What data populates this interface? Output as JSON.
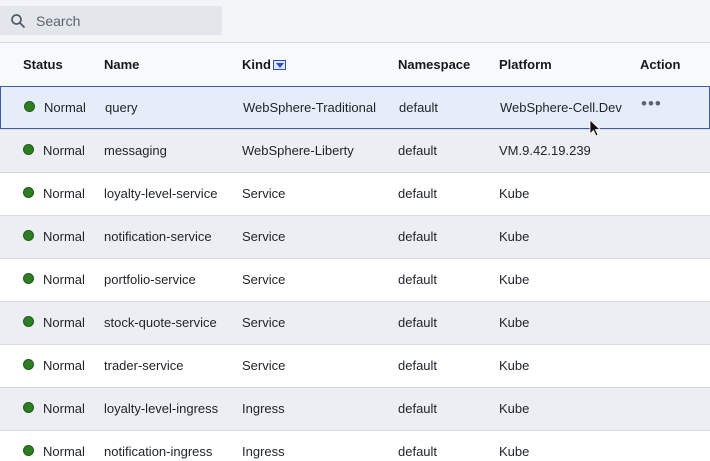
{
  "search": {
    "placeholder": "Search"
  },
  "columns": [
    "Status",
    "Name",
    "Kind",
    "Namespace",
    "Platform",
    "Action"
  ],
  "status_color": "#2f7d23",
  "selected_row_border": "#3b5da7",
  "rows": [
    {
      "status": "Normal",
      "name": "query",
      "kind": "WebSphere-Traditional",
      "namespace": "default",
      "platform": "WebSphere-Cell.Dev",
      "action": "•••"
    },
    {
      "status": "Normal",
      "name": "messaging",
      "kind": "WebSphere-Liberty",
      "namespace": "default",
      "platform": "VM.9.42.19.239",
      "action": ""
    },
    {
      "status": "Normal",
      "name": "loyalty-level-service",
      "kind": "Service",
      "namespace": "default",
      "platform": "Kube",
      "action": ""
    },
    {
      "status": "Normal",
      "name": "notification-service",
      "kind": "Service",
      "namespace": "default",
      "platform": "Kube",
      "action": ""
    },
    {
      "status": "Normal",
      "name": "portfolio-service",
      "kind": "Service",
      "namespace": "default",
      "platform": "Kube",
      "action": ""
    },
    {
      "status": "Normal",
      "name": "stock-quote-service",
      "kind": "Service",
      "namespace": "default",
      "platform": "Kube",
      "action": ""
    },
    {
      "status": "Normal",
      "name": "trader-service",
      "kind": "Service",
      "namespace": "default",
      "platform": "Kube",
      "action": ""
    },
    {
      "status": "Normal",
      "name": "loyalty-level-ingress",
      "kind": "Ingress",
      "namespace": "default",
      "platform": "Kube",
      "action": ""
    },
    {
      "status": "Normal",
      "name": "notification-ingress",
      "kind": "Ingress",
      "namespace": "default",
      "platform": "Kube",
      "action": ""
    }
  ]
}
